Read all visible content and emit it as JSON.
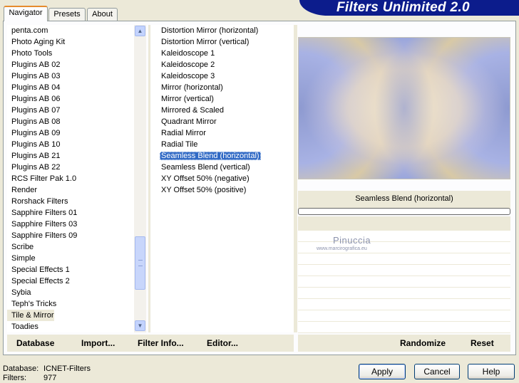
{
  "app": {
    "title": "Filters Unlimited 2.0"
  },
  "tabs": [
    {
      "label": "Navigator",
      "active": true
    },
    {
      "label": "Presets",
      "active": false
    },
    {
      "label": "About",
      "active": false
    }
  ],
  "categories": [
    "penta.com",
    "Photo Aging Kit",
    "Photo Tools",
    "Plugins AB 02",
    "Plugins AB 03",
    "Plugins AB 04",
    "Plugins AB 06",
    "Plugins AB 07",
    "Plugins AB 08",
    "Plugins AB 09",
    "Plugins AB 10",
    "Plugins AB 21",
    "Plugins AB 22",
    "RCS Filter Pak 1.0",
    "Render",
    "Rorshack Filters",
    "Sapphire Filters 01",
    "Sapphire Filters 03",
    "Sapphire Filters 09",
    "Scribe",
    "Simple",
    "Special Effects 1",
    "Special Effects 2",
    "Sybia",
    "Teph's Tricks",
    "Tile & Mirror",
    "Toadies"
  ],
  "selected_category": "Tile & Mirror",
  "filters": [
    "Distortion Mirror (horizontal)",
    "Distortion Mirror (vertical)",
    "Kaleidoscope 1",
    "Kaleidoscope 2",
    "Kaleidoscope 3",
    "Mirror (horizontal)",
    "Mirror (vertical)",
    "Mirrored & Scaled",
    "Quadrant Mirror",
    "Radial Mirror",
    "Radial Tile",
    "Seamless Blend (horizontal)",
    "Seamless Blend (vertical)",
    "XY Offset 50% (negative)",
    "XY Offset 50% (positive)"
  ],
  "selected_filter": "Seamless Blend (horizontal)",
  "preview": {
    "filter_name": "Seamless Blend (horizontal)",
    "watermark_name": "Pinuccia",
    "watermark_url": "www.marcirografica.eu"
  },
  "toolbar": {
    "database": "Database",
    "import": "Import...",
    "filter_info": "Filter Info...",
    "editor": "Editor...",
    "randomize": "Randomize",
    "reset": "Reset"
  },
  "footer": {
    "database_label": "Database:",
    "database_value": "ICNET-Filters",
    "filters_label": "Filters:",
    "filters_value": "977"
  },
  "buttons": {
    "apply": "Apply",
    "cancel": "Cancel",
    "help": "Help"
  },
  "colors": {
    "banner": "#0c1c8c",
    "selection": "#316ac5",
    "dialog_bg": "#ece9d8"
  }
}
